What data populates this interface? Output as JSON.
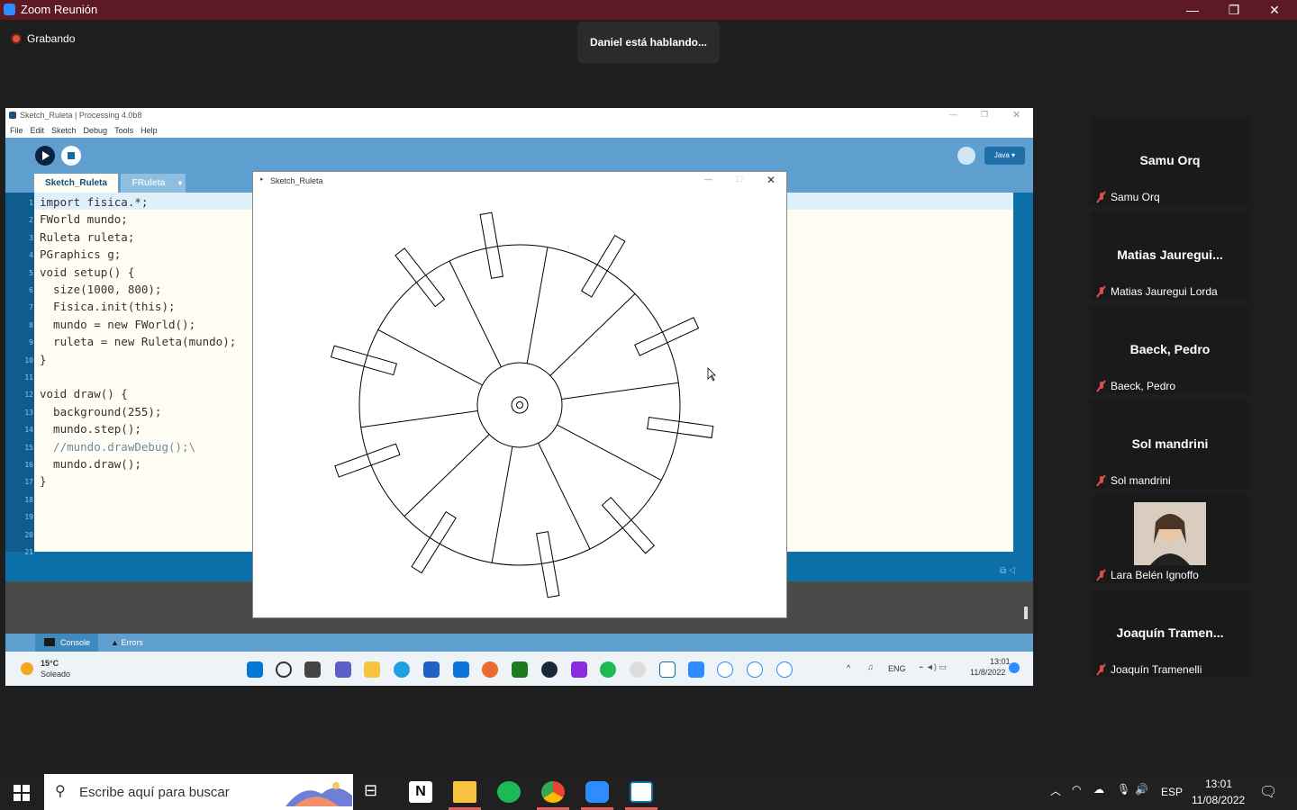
{
  "zoom": {
    "title": "Zoom Reunión",
    "recording_label": "Grabando",
    "speaker_notice": "Daniel está hablando..."
  },
  "processing": {
    "title": "Sketch_Ruleta | Processing 4.0b8",
    "menu": [
      "File",
      "Edit",
      "Sketch",
      "Debug",
      "Tools",
      "Help"
    ],
    "mode": "Java ▾",
    "tabs": [
      "Sketch_Ruleta",
      "FRuleta"
    ],
    "console_tabs": [
      "Console",
      "Errors"
    ],
    "line_numbers": [
      "1",
      "2",
      "3",
      "4",
      "5",
      "6",
      "7",
      "8",
      "9",
      "10",
      "11",
      "12",
      "13",
      "14",
      "15",
      "16",
      "17",
      "18",
      "19",
      "20",
      "21"
    ],
    "code_lines": [
      "import fisica.*;",
      "FWorld mundo;",
      "Ruleta ruleta;",
      "PGraphics g;",
      "void setup() {",
      "  size(1000, 800);",
      "  Fisica.init(this);",
      "  mundo = new FWorld();",
      "  ruleta = new Ruleta(mundo);",
      "}",
      "",
      "void draw() {",
      "  background(255);",
      "  mundo.step();",
      "  //mundo.drawDebug();\\",
      "  mundo.draw();",
      "}"
    ]
  },
  "sketch_window": {
    "title": "Sketch_Ruleta"
  },
  "shared_taskbar": {
    "weather_temp": "15°C",
    "weather_desc": "Soleado",
    "lang": "ENG",
    "time": "13:01",
    "date": "11/8/2022"
  },
  "participants": [
    {
      "display": "Samu Orq",
      "name": "Samu Orq"
    },
    {
      "display": "Matias  Jauregui...",
      "name": "Matias Jauregui Lorda"
    },
    {
      "display": "Baeck, Pedro",
      "name": "Baeck, Pedro"
    },
    {
      "display": "Sol mandrini",
      "name": "Sol mandrini"
    },
    {
      "display": "",
      "name": "Lara Belén Ignoffo"
    },
    {
      "display": "Joaquín  Tramen...",
      "name": "Joaquín Tramenelli"
    }
  ],
  "taskbar": {
    "search_placeholder": "Escribe aquí para buscar",
    "lang": "ESP",
    "time": "13:01",
    "date": "11/08/2022"
  },
  "colors": {
    "zoom_bar": "#5c1a25",
    "processing_blue": "#0d6fa8",
    "accent": "#2d8cff"
  }
}
